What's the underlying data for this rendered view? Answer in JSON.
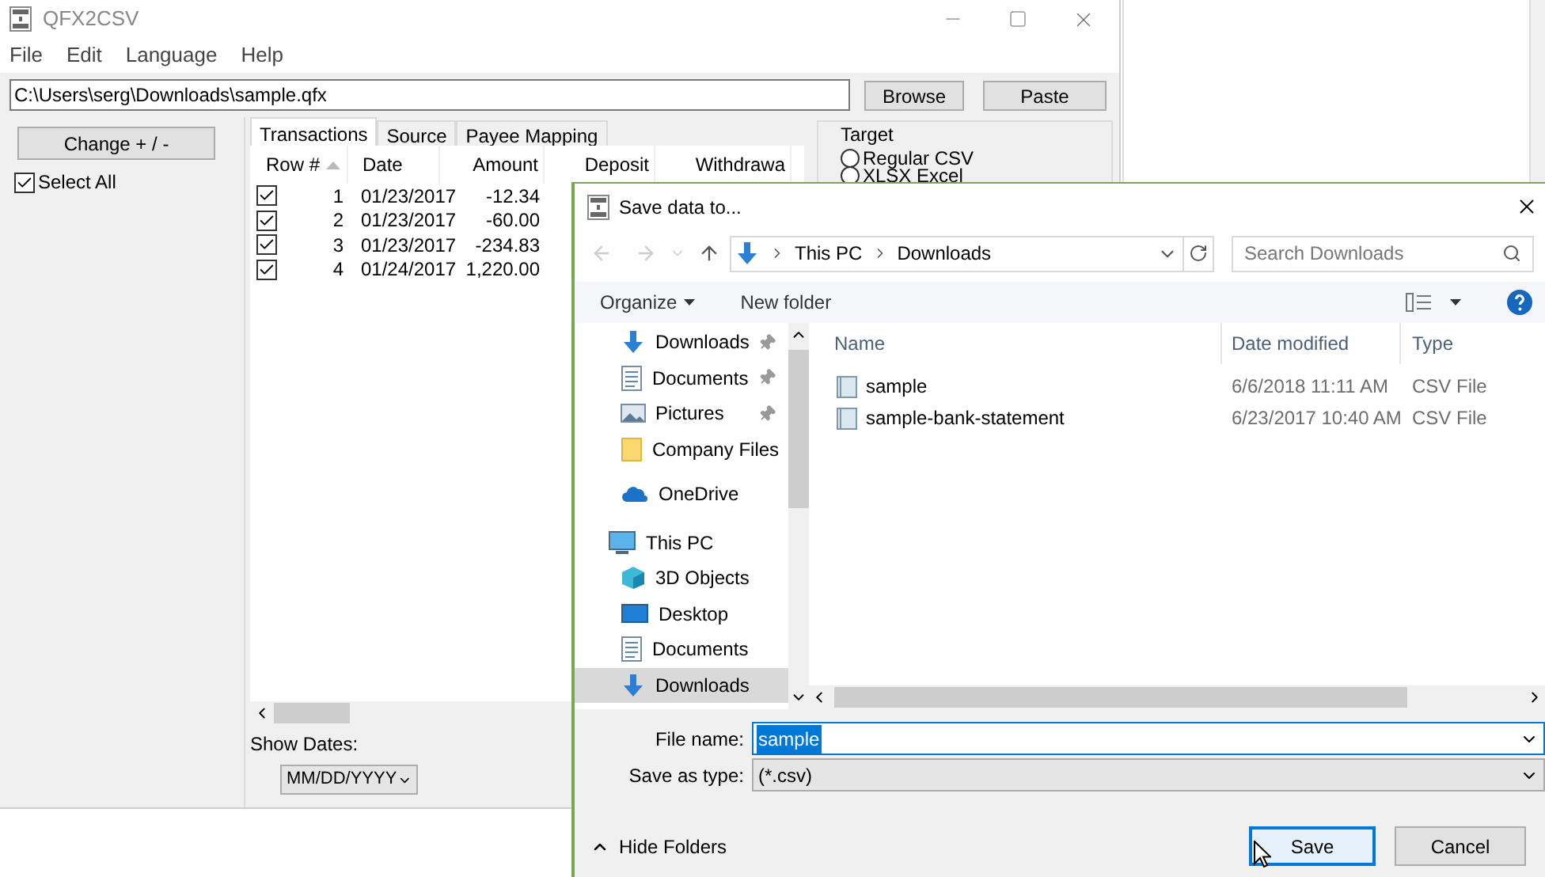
{
  "main_window": {
    "title": "QFX2CSV",
    "menu": [
      "File",
      "Edit",
      "Language",
      "Help"
    ],
    "path": "C:\\Users\\serg\\Downloads\\sample.qfx",
    "buttons": [
      "Browse",
      "Paste"
    ],
    "change_button": "Change + / -",
    "select_all": {
      "label": "Select All",
      "checked": true
    },
    "tabs": [
      {
        "label": "Transactions",
        "selected": true
      },
      {
        "label": "Source",
        "selected": false
      },
      {
        "label": "Payee Mapping",
        "selected": false
      }
    ],
    "table": {
      "columns": [
        "Row #",
        "Date",
        "Amount",
        "Deposit",
        "Withdrawa"
      ],
      "rows": [
        {
          "checked": true,
          "cells": [
            "1",
            "01/23/2017",
            "-12.34"
          ]
        },
        {
          "checked": true,
          "cells": [
            "2",
            "01/23/2017",
            "-60.00"
          ]
        },
        {
          "checked": true,
          "cells": [
            "3",
            "01/23/2017",
            "-234.83"
          ]
        },
        {
          "checked": true,
          "cells": [
            "4",
            "01/24/2017",
            "1,220.00"
          ]
        }
      ]
    },
    "show_dates": {
      "label": "Show Dates:",
      "value": "MM/DD/YYYY"
    },
    "target": {
      "title": "Target",
      "options": [
        {
          "label": "Regular CSV",
          "selected": false
        },
        {
          "label": "XLSX Excel",
          "selected": false
        }
      ]
    }
  },
  "dialog": {
    "title": "Save data to...",
    "breadcrumb": [
      "This PC",
      "Downloads"
    ],
    "search": {
      "placeholder": "Search Downloads"
    },
    "toolbar": [
      "Organize",
      "New folder"
    ],
    "nav": [
      {
        "label": "Downloads",
        "kind": "download",
        "pinned": true,
        "selected": false
      },
      {
        "label": "Documents",
        "kind": "document",
        "pinned": true,
        "selected": false
      },
      {
        "label": "Pictures",
        "kind": "picture",
        "pinned": true,
        "selected": false
      },
      {
        "label": "Company Files",
        "kind": "folder",
        "pinned": false,
        "selected": false
      },
      {
        "label": "OneDrive",
        "kind": "cloud",
        "pinned": false,
        "selected": false
      },
      {
        "label": "This PC",
        "kind": "pc",
        "pinned": false,
        "selected": false,
        "children": [
          {
            "label": "3D Objects",
            "kind": "cube",
            "pinned": false,
            "selected": false
          },
          {
            "label": "Desktop",
            "kind": "desktop",
            "pinned": false,
            "selected": false
          },
          {
            "label": "Documents",
            "kind": "document",
            "pinned": false,
            "selected": false
          },
          {
            "label": "Downloads",
            "kind": "download",
            "pinned": false,
            "selected": true
          }
        ]
      }
    ],
    "columns": [
      "Name",
      "Date modified",
      "Type"
    ],
    "files": [
      {
        "name": "sample",
        "date": "6/6/2018 11:11 AM",
        "type": "CSV File"
      },
      {
        "name": "sample-bank-statement",
        "date": "6/23/2017 10:40 AM",
        "type": "CSV File"
      }
    ],
    "file_name": {
      "label": "File name:",
      "value": "sample"
    },
    "save_type": {
      "label": "Save as type:",
      "value": "(*.csv)"
    },
    "hide_folders": "Hide Folders",
    "buttons": [
      "Save",
      "Cancel"
    ]
  }
}
